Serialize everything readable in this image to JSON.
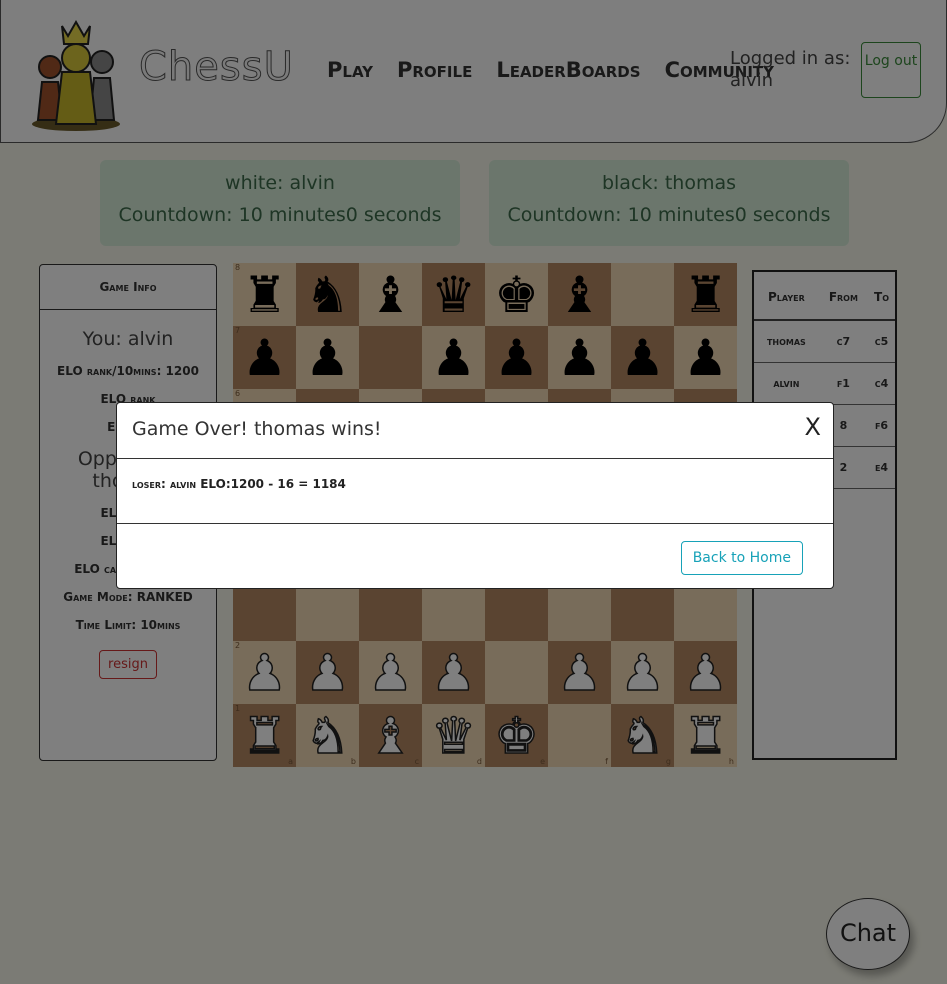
{
  "header": {
    "brand": "ChessU",
    "nav": [
      "Play",
      "Profile",
      "LeaderBoards",
      "Community"
    ],
    "logged_in_label": "Logged in as:",
    "username": "alvin",
    "logout_label": "Log out"
  },
  "timers": {
    "white": {
      "label": "white: alvin",
      "countdown": "Countdown: 10 minutes0 seconds"
    },
    "black": {
      "label": "black: thomas",
      "countdown": "Countdown: 10 minutes0 seconds"
    }
  },
  "game_info": {
    "header": "Game Info",
    "you": "You: alvin",
    "your_rows": [
      "ELO rank/10mins: 1200",
      "ELO rank",
      "ELO ca"
    ],
    "opponent": "Opponent: thomas",
    "opp_rows": [
      "ELO rank",
      "ELO rank",
      "ELO casual: 1791"
    ],
    "game_mode": "Game Mode: RANKED",
    "time_limit": "Time Limit: 10mins",
    "resign_label": "resign"
  },
  "board": {
    "colors": {
      "light": "#f0d9b5",
      "dark": "#b58863"
    },
    "rows": [
      [
        "br",
        "bn",
        "bb",
        "bq",
        "bk",
        "bb",
        "",
        "br"
      ],
      [
        "bp",
        "bp",
        "",
        "bp",
        "bp",
        "bp",
        "bp",
        "bp"
      ],
      [
        "",
        "",
        "",
        "",
        "",
        "",
        "",
        ""
      ],
      [
        "",
        "",
        "",
        "",
        "",
        "",
        "",
        ""
      ],
      [
        "",
        "",
        "",
        "",
        "",
        "",
        "",
        ""
      ],
      [
        "",
        "",
        "",
        "",
        "",
        "",
        "",
        ""
      ],
      [
        "wp",
        "wp",
        "wp",
        "wp",
        "",
        "wp",
        "wp",
        "wp"
      ],
      [
        "wr",
        "wn",
        "wb",
        "wq",
        "wk",
        "",
        "wn",
        "wr"
      ]
    ],
    "ranks": [
      "8",
      "7",
      "6",
      "5",
      "4",
      "3",
      "2",
      "1"
    ],
    "files": [
      "a",
      "b",
      "c",
      "d",
      "e",
      "f",
      "g",
      "h"
    ]
  },
  "moves": {
    "headers": [
      "Player",
      "From",
      "To"
    ],
    "rows": [
      [
        "thomas",
        "c7",
        "c5"
      ],
      [
        "alvin",
        "f1",
        "c4"
      ],
      [
        "",
        "8",
        "f6"
      ],
      [
        "",
        "2",
        "e4"
      ]
    ]
  },
  "chat_label": "Chat",
  "modal": {
    "title": "Game Over! thomas wins!",
    "close": "X",
    "loser_label": "loser: alvin",
    "elo_text": "ELO:1200 - 16 = 1184",
    "home_button": "Back to Home"
  }
}
